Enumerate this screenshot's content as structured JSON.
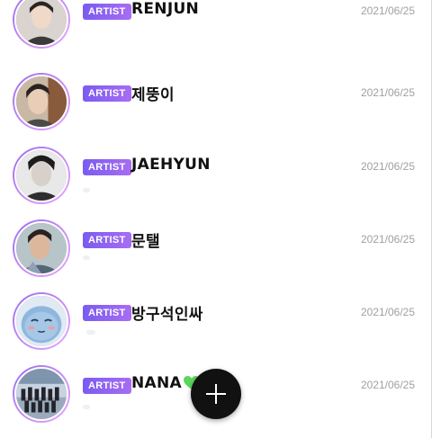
{
  "artists": [
    {
      "badge": "ARTIST",
      "name": "RENJUN",
      "date": "2021/06/25",
      "avatar_icon": "profile-photo"
    },
    {
      "badge": "ARTIST",
      "name": "제뚱이",
      "date": "2021/06/25",
      "avatar_icon": "profile-photo"
    },
    {
      "badge": "ARTIST",
      "name": "JAEHYUN",
      "date": "2021/06/25",
      "avatar_icon": "profile-photo"
    },
    {
      "badge": "ARTIST",
      "name": "문탤",
      "date": "2021/06/25",
      "avatar_icon": "profile-photo"
    },
    {
      "badge": "ARTIST",
      "name": "방구석인싸",
      "date": "2021/06/25",
      "avatar_icon": "cartoon-character"
    },
    {
      "badge": "ARTIST",
      "name": "NANA",
      "date": "2021/06/25",
      "avatar_icon": "group-photo"
    }
  ],
  "fab": {
    "icon": "plus-icon"
  },
  "colors": {
    "badge_start": "#7a5cf0",
    "badge_end": "#a86df2",
    "ring": "#b07cf2",
    "date": "#a0a0a0",
    "heart": "#5cd65c",
    "fab": "#111111"
  }
}
